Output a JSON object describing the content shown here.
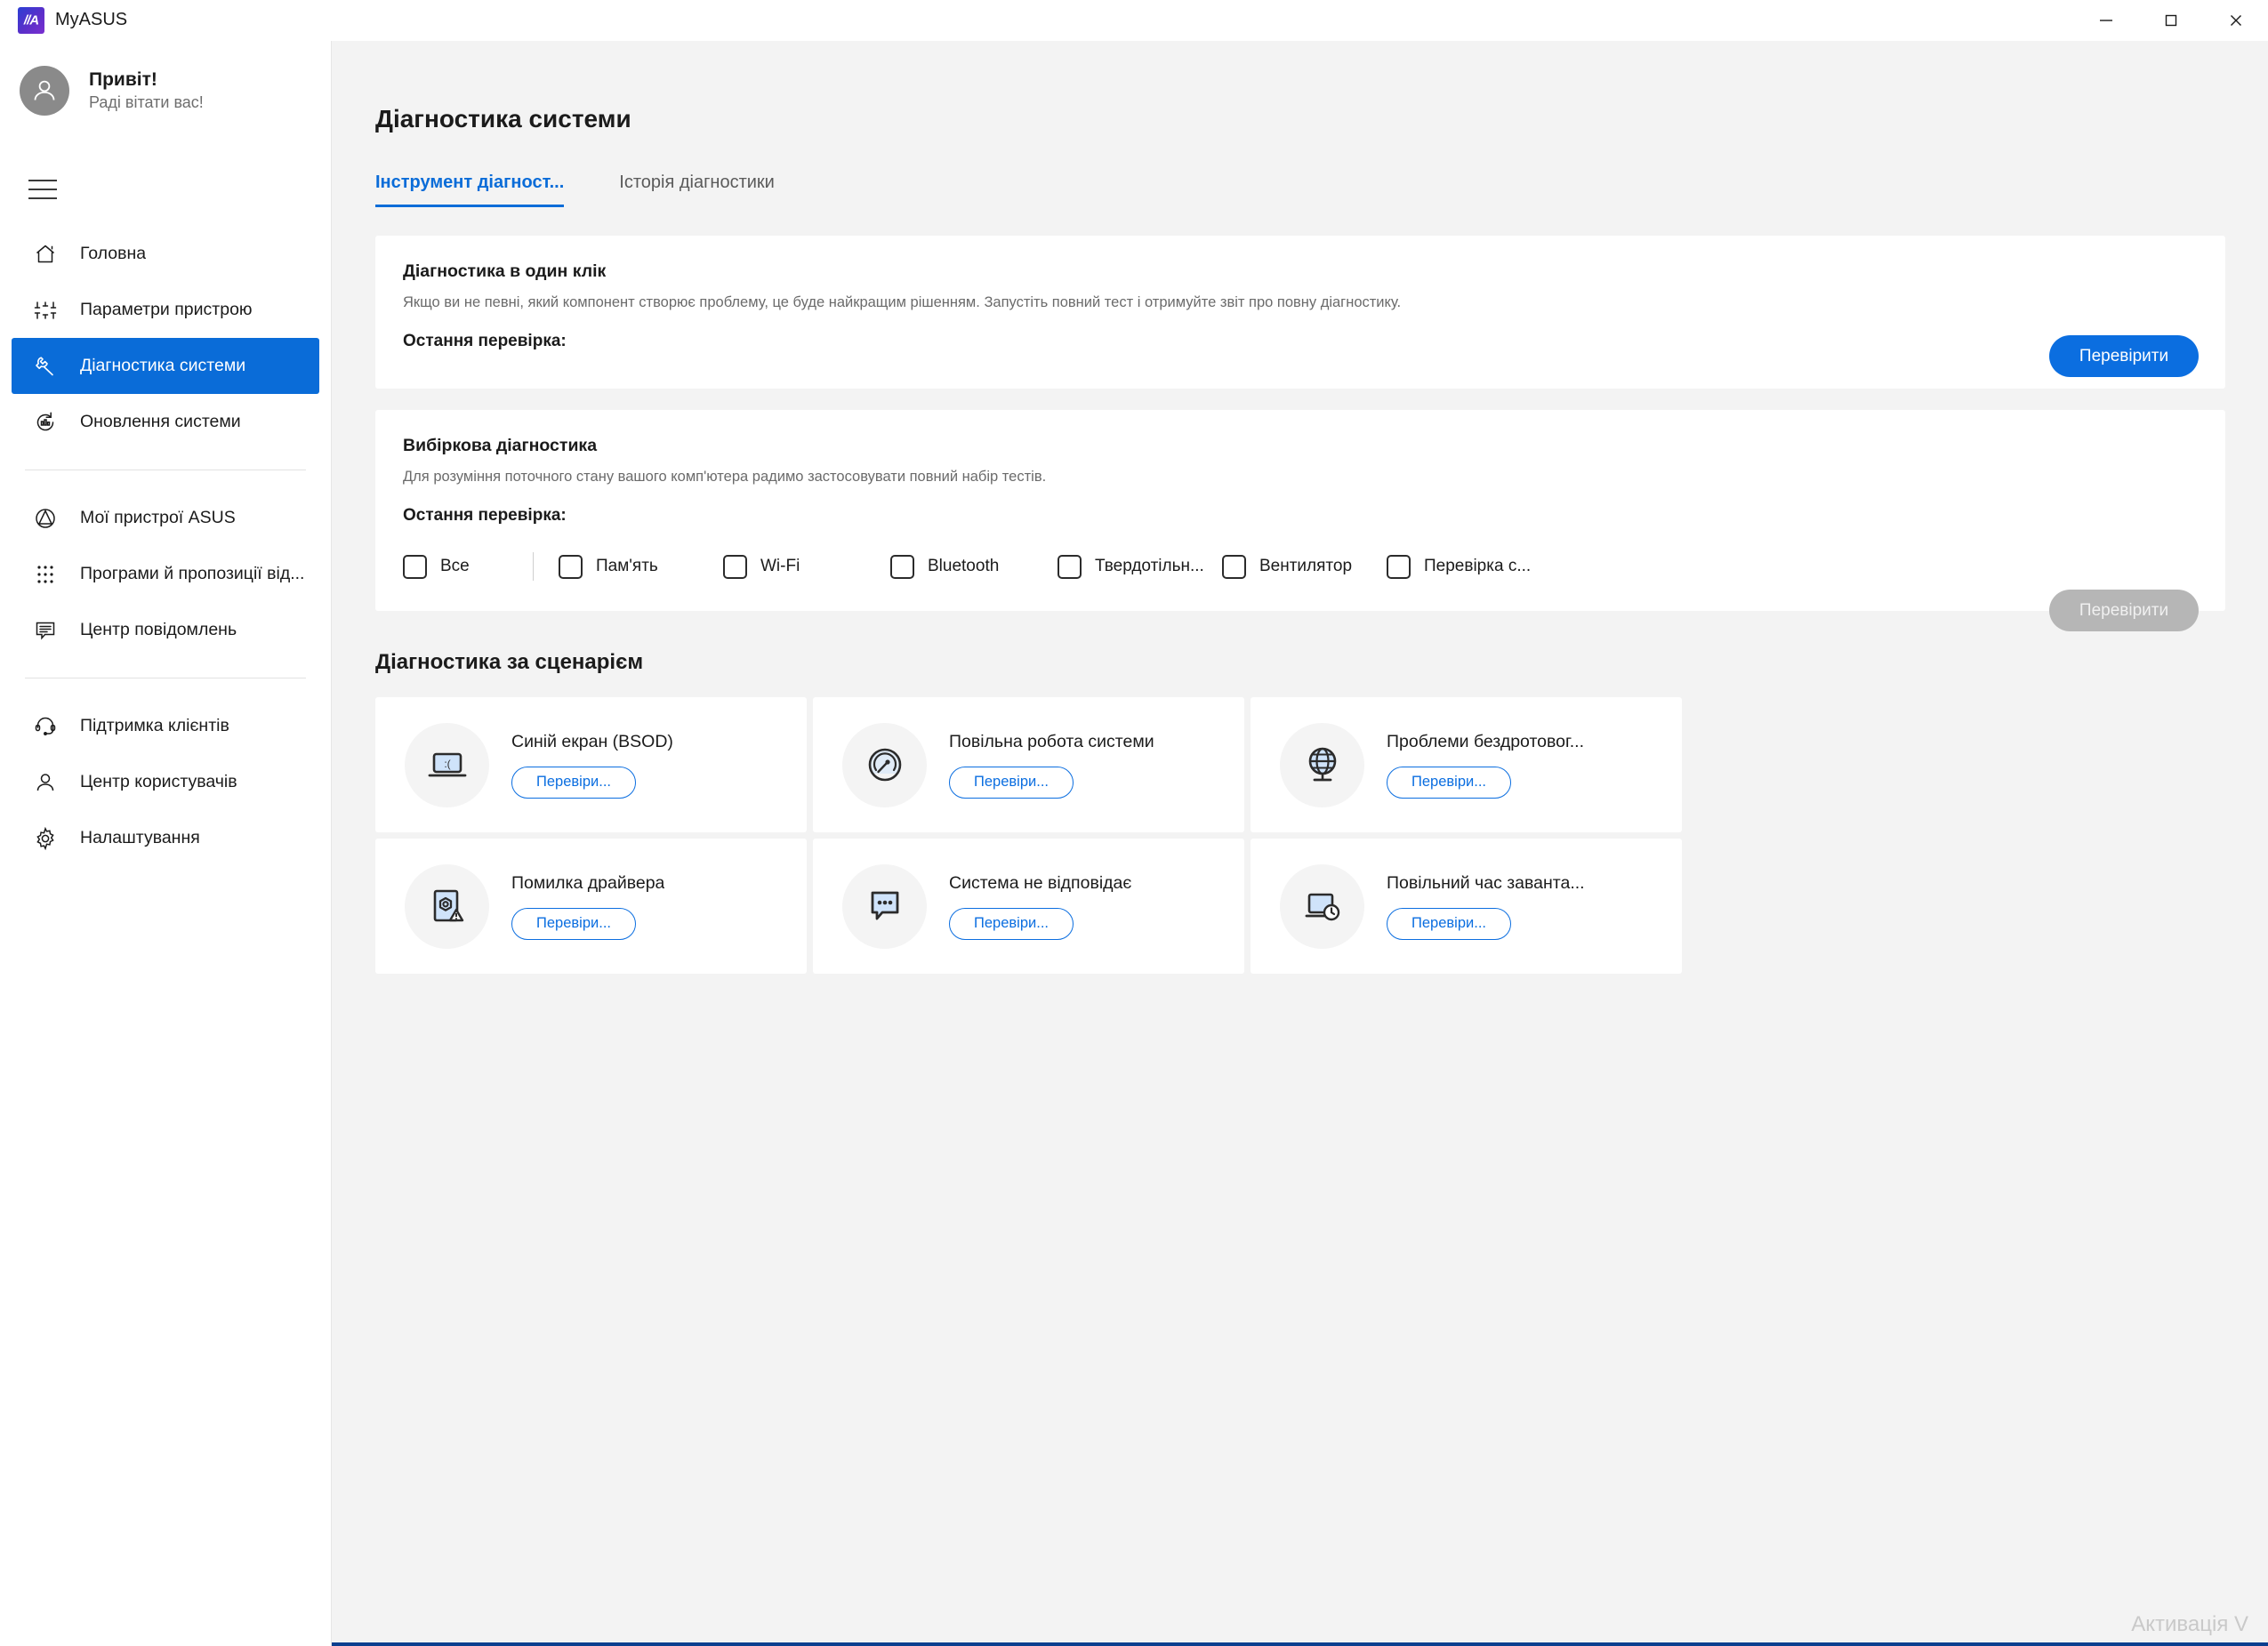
{
  "window": {
    "app_title": "MyASUS",
    "logo_text": "//A",
    "controls": {
      "minimize": "minimize-icon",
      "maximize": "maximize-icon",
      "close": "close-icon"
    }
  },
  "sidebar": {
    "profile": {
      "greeting": "Привіт!",
      "subtitle": "Раді вітати вас!",
      "avatar_icon": "person-icon"
    },
    "menu_icon": "hamburger-icon",
    "items": [
      {
        "label": "Головна",
        "icon": "home-icon",
        "active": false
      },
      {
        "label": "Параметри пристрою",
        "icon": "sliders-icon",
        "active": false
      },
      {
        "label": "Діагностика системи",
        "icon": "wrench-icon",
        "active": true
      },
      {
        "label": "Оновлення системи",
        "icon": "update-icon",
        "active": false
      },
      {
        "label": "Мої пристрої ASUS",
        "icon": "asus-devices-icon",
        "active": false
      },
      {
        "label": "Програми й пропозиції від...",
        "icon": "apps-grid-icon",
        "active": false
      },
      {
        "label": "Центр повідомлень",
        "icon": "message-icon",
        "active": false
      },
      {
        "label": "Підтримка клієнтів",
        "icon": "headset-icon",
        "active": false
      },
      {
        "label": "Центр користувачів",
        "icon": "user-icon",
        "active": false
      },
      {
        "label": "Налаштування",
        "icon": "gear-icon",
        "active": false
      }
    ]
  },
  "main": {
    "page_title": "Діагностика системи",
    "tabs": [
      {
        "label": "Інструмент діагност...",
        "active": true
      },
      {
        "label": "Історія діагностики",
        "active": false
      }
    ],
    "one_click": {
      "title": "Діагностика в один клік",
      "description": "Якщо ви не певні, який компонент створює проблему, це буде найкращим рішенням. Запустіть повний тест і отримуйте звіт про повну діагностику.",
      "last_check_label": "Остання перевірка:",
      "last_check_value": "",
      "button_label": "Перевірити"
    },
    "selective": {
      "title": "Вибіркова діагностика",
      "description": "Для розуміння поточного стану вашого комп'ютера радимо застосовувати повний набір тестів.",
      "last_check_label": "Остання перевірка:",
      "last_check_value": "",
      "button_label": "Перевірити",
      "button_disabled": true,
      "checkboxes": [
        {
          "label": "Все",
          "checked": false
        },
        {
          "label": "Пам'ять",
          "checked": false
        },
        {
          "label": "Wi-Fi",
          "checked": false
        },
        {
          "label": "Bluetooth",
          "checked": false
        },
        {
          "label": "Твердотільн...",
          "checked": false
        },
        {
          "label": "Вентилятор",
          "checked": false
        },
        {
          "label": "Перевірка с...",
          "checked": false
        }
      ]
    },
    "scenario": {
      "title": "Діагностика за сценарієм",
      "cards": [
        {
          "title": "Синій екран (BSOD)",
          "button_label": "Перевіри...",
          "icon": "bsod-laptop-icon"
        },
        {
          "title": "Повільна робота системи",
          "button_label": "Перевіри...",
          "icon": "speedometer-icon"
        },
        {
          "title": "Проблеми бездротовог...",
          "button_label": "Перевіри...",
          "icon": "globe-icon"
        },
        {
          "title": "Помилка драйвера",
          "button_label": "Перевіри...",
          "icon": "driver-error-icon"
        },
        {
          "title": "Система не відповідає",
          "button_label": "Перевіри...",
          "icon": "chat-dots-icon"
        },
        {
          "title": "Повільний час заванта...",
          "button_label": "Перевіри...",
          "icon": "slow-boot-icon"
        }
      ]
    }
  },
  "watermark": "Активація V",
  "colors": {
    "accent": "#0b6ee0",
    "active_nav": "#0a6cd8",
    "panel_bg": "#ffffff",
    "main_bg": "#f3f3f3",
    "icon_fill": "#cfe3fa",
    "disabled": "#b6b6b6"
  }
}
